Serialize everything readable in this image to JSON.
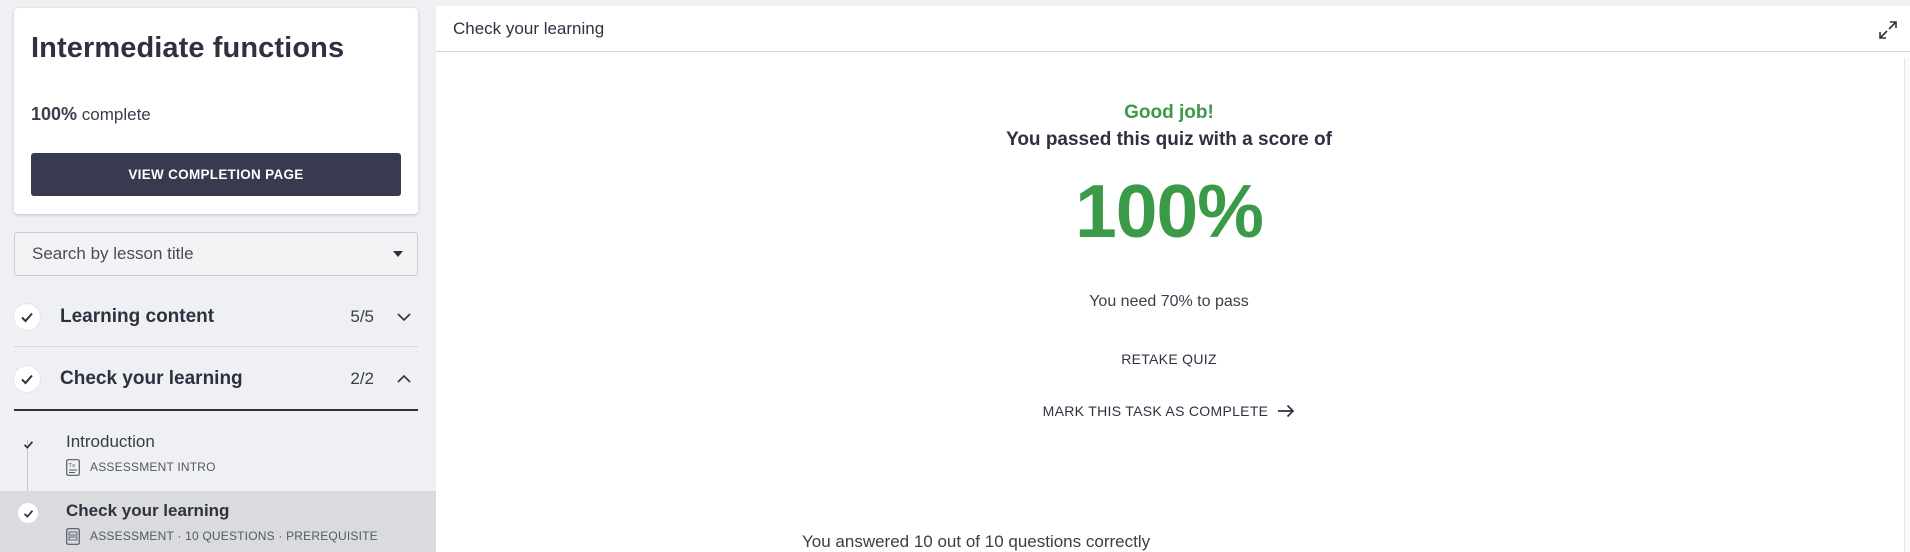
{
  "sidebar": {
    "course_title": "Intermediate functions",
    "progress": {
      "percent": "100%",
      "suffix": "complete",
      "value": 100
    },
    "completion_button": "VIEW COMPLETION PAGE",
    "search_placeholder": "Search by lesson title",
    "sections": [
      {
        "title": "Learning content",
        "count": "5/5",
        "expanded": false,
        "completed": true
      },
      {
        "title": "Check your learning",
        "count": "2/2",
        "expanded": true,
        "completed": true
      }
    ],
    "lessons": [
      {
        "title": "Introduction",
        "meta": "ASSESSMENT INTRO",
        "completed": true,
        "selected": false,
        "icon": "text-document-icon"
      },
      {
        "title": "Check your learning",
        "meta": "ASSESSMENT · 10 QUESTIONS · PREREQUISITE",
        "completed": true,
        "selected": true,
        "icon": "quiz-document-icon"
      }
    ]
  },
  "main": {
    "header_title": "Check your learning",
    "result": {
      "headline": "Good job!",
      "subline": "You passed this quiz with a score of",
      "score": "100%",
      "pass_requirement": "You need 70% to pass",
      "retake_label": "RETAKE QUIZ",
      "complete_label": "MARK THIS TASK AS COMPLETE",
      "answered": "You answered 10 out of 10 questions correctly"
    }
  },
  "colors": {
    "accent_green": "#3a9a48",
    "dark_button": "#383a4f",
    "text": "#2f3140",
    "sidebar_bg": "#eef0f3",
    "selected_bg": "#d9dbdf"
  }
}
